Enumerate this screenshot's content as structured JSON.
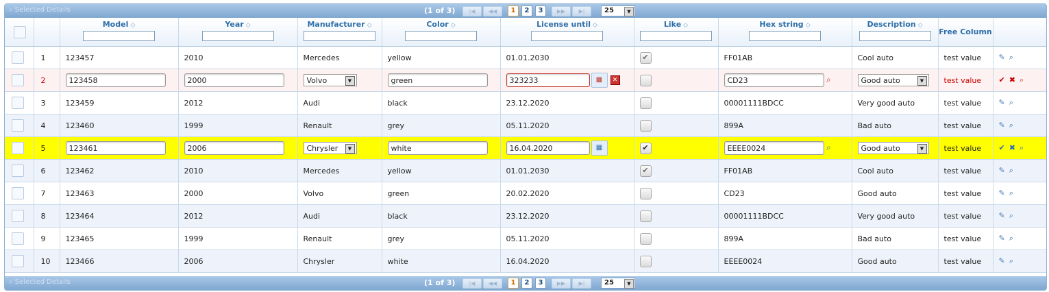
{
  "pager": {
    "selected_details": "Selected Details",
    "page_info": "(1 of 3)",
    "pages": [
      "1",
      "2",
      "3"
    ],
    "current_page": "1",
    "page_size": "25",
    "first_icon": "first-page-icon",
    "prev_icon": "prev-page-icon",
    "next_icon": "next-page-icon",
    "last_icon": "last-page-icon"
  },
  "columns": {
    "model": "Model",
    "year": "Year",
    "manufacturer": "Manufacturer",
    "color": "Color",
    "license": "License until",
    "like": "Like",
    "hex": "Hex string",
    "description": "Description",
    "free": "Free Column"
  },
  "rows": [
    {
      "idx": "1",
      "model": "123457",
      "year": "2010",
      "manufacturer": "Mercedes",
      "color": "yellow",
      "license": "01.01.2030",
      "like": true,
      "hex": "FF01AB",
      "description": "Cool auto",
      "free": "test value"
    },
    {
      "idx": "2",
      "model": "123458",
      "year": "2000",
      "manufacturer": "Volvo",
      "color": "green",
      "license": "323233",
      "like": false,
      "hex": "CD23",
      "description": "Good auto",
      "free": "test value"
    },
    {
      "idx": "3",
      "model": "123459",
      "year": "2012",
      "manufacturer": "Audi",
      "color": "black",
      "license": "23.12.2020",
      "like": false,
      "hex": "00001111BDCC",
      "description": "Very good auto",
      "free": "test value"
    },
    {
      "idx": "4",
      "model": "123460",
      "year": "1999",
      "manufacturer": "Renault",
      "color": "grey",
      "license": "05.11.2020",
      "like": false,
      "hex": "899A",
      "description": "Bad auto",
      "free": "test value"
    },
    {
      "idx": "5",
      "model": "123461",
      "year": "2006",
      "manufacturer": "Chrysler",
      "color": "white",
      "license": "16.04.2020",
      "like": true,
      "hex": "EEEE0024",
      "description": "Good auto",
      "free": "test value"
    },
    {
      "idx": "6",
      "model": "123462",
      "year": "2010",
      "manufacturer": "Mercedes",
      "color": "yellow",
      "license": "01.01.2030",
      "like": true,
      "hex": "FF01AB",
      "description": "Cool auto",
      "free": "test value"
    },
    {
      "idx": "7",
      "model": "123463",
      "year": "2000",
      "manufacturer": "Volvo",
      "color": "green",
      "license": "20.02.2020",
      "like": false,
      "hex": "CD23",
      "description": "Good auto",
      "free": "test value"
    },
    {
      "idx": "8",
      "model": "123464",
      "year": "2012",
      "manufacturer": "Audi",
      "color": "black",
      "license": "23.12.2020",
      "like": false,
      "hex": "00001111BDCC",
      "description": "Very good auto",
      "free": "test value"
    },
    {
      "idx": "9",
      "model": "123465",
      "year": "1999",
      "manufacturer": "Renault",
      "color": "grey",
      "license": "05.11.2020",
      "like": false,
      "hex": "899A",
      "description": "Bad auto",
      "free": "test value"
    },
    {
      "idx": "10",
      "model": "123466",
      "year": "2006",
      "manufacturer": "Chrysler",
      "color": "white",
      "license": "16.04.2020",
      "like": false,
      "hex": "EEEE0024",
      "description": "Good auto",
      "free": "test value"
    }
  ],
  "colors": {
    "header_text": "#2e6ea8",
    "edit_error_row": "#fdf1f1",
    "edit_active_row": "#ffff00",
    "error_text": "#cc0000"
  }
}
